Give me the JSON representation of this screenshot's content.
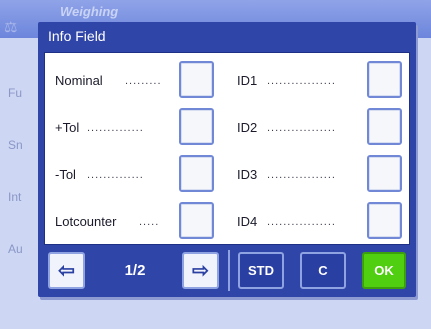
{
  "background": {
    "title": "Weighing",
    "labels": [
      "Fu",
      "Sn",
      "Int",
      "Au"
    ]
  },
  "dialog": {
    "title": "Info Field",
    "rows_left": [
      {
        "label": "Nominal",
        "dots": "........."
      },
      {
        "label": "+Tol",
        "dots": ".............."
      },
      {
        "label": "-Tol",
        "dots": ".............."
      },
      {
        "label": "Lotcounter",
        "dots": "....."
      }
    ],
    "rows_right": [
      {
        "label": "ID1",
        "dots": "................."
      },
      {
        "label": "ID2",
        "dots": "................."
      },
      {
        "label": "ID3",
        "dots": "................."
      },
      {
        "label": "ID4",
        "dots": "................."
      }
    ]
  },
  "footer": {
    "prev_icon": "arrow-left-icon",
    "page": "1/2",
    "next_icon": "arrow-right-icon",
    "std_label": "STD",
    "c_label": "C",
    "ok_label": "OK"
  },
  "colors": {
    "dialog_bg": "#2f45a8",
    "ok_green": "#4fcf10"
  }
}
